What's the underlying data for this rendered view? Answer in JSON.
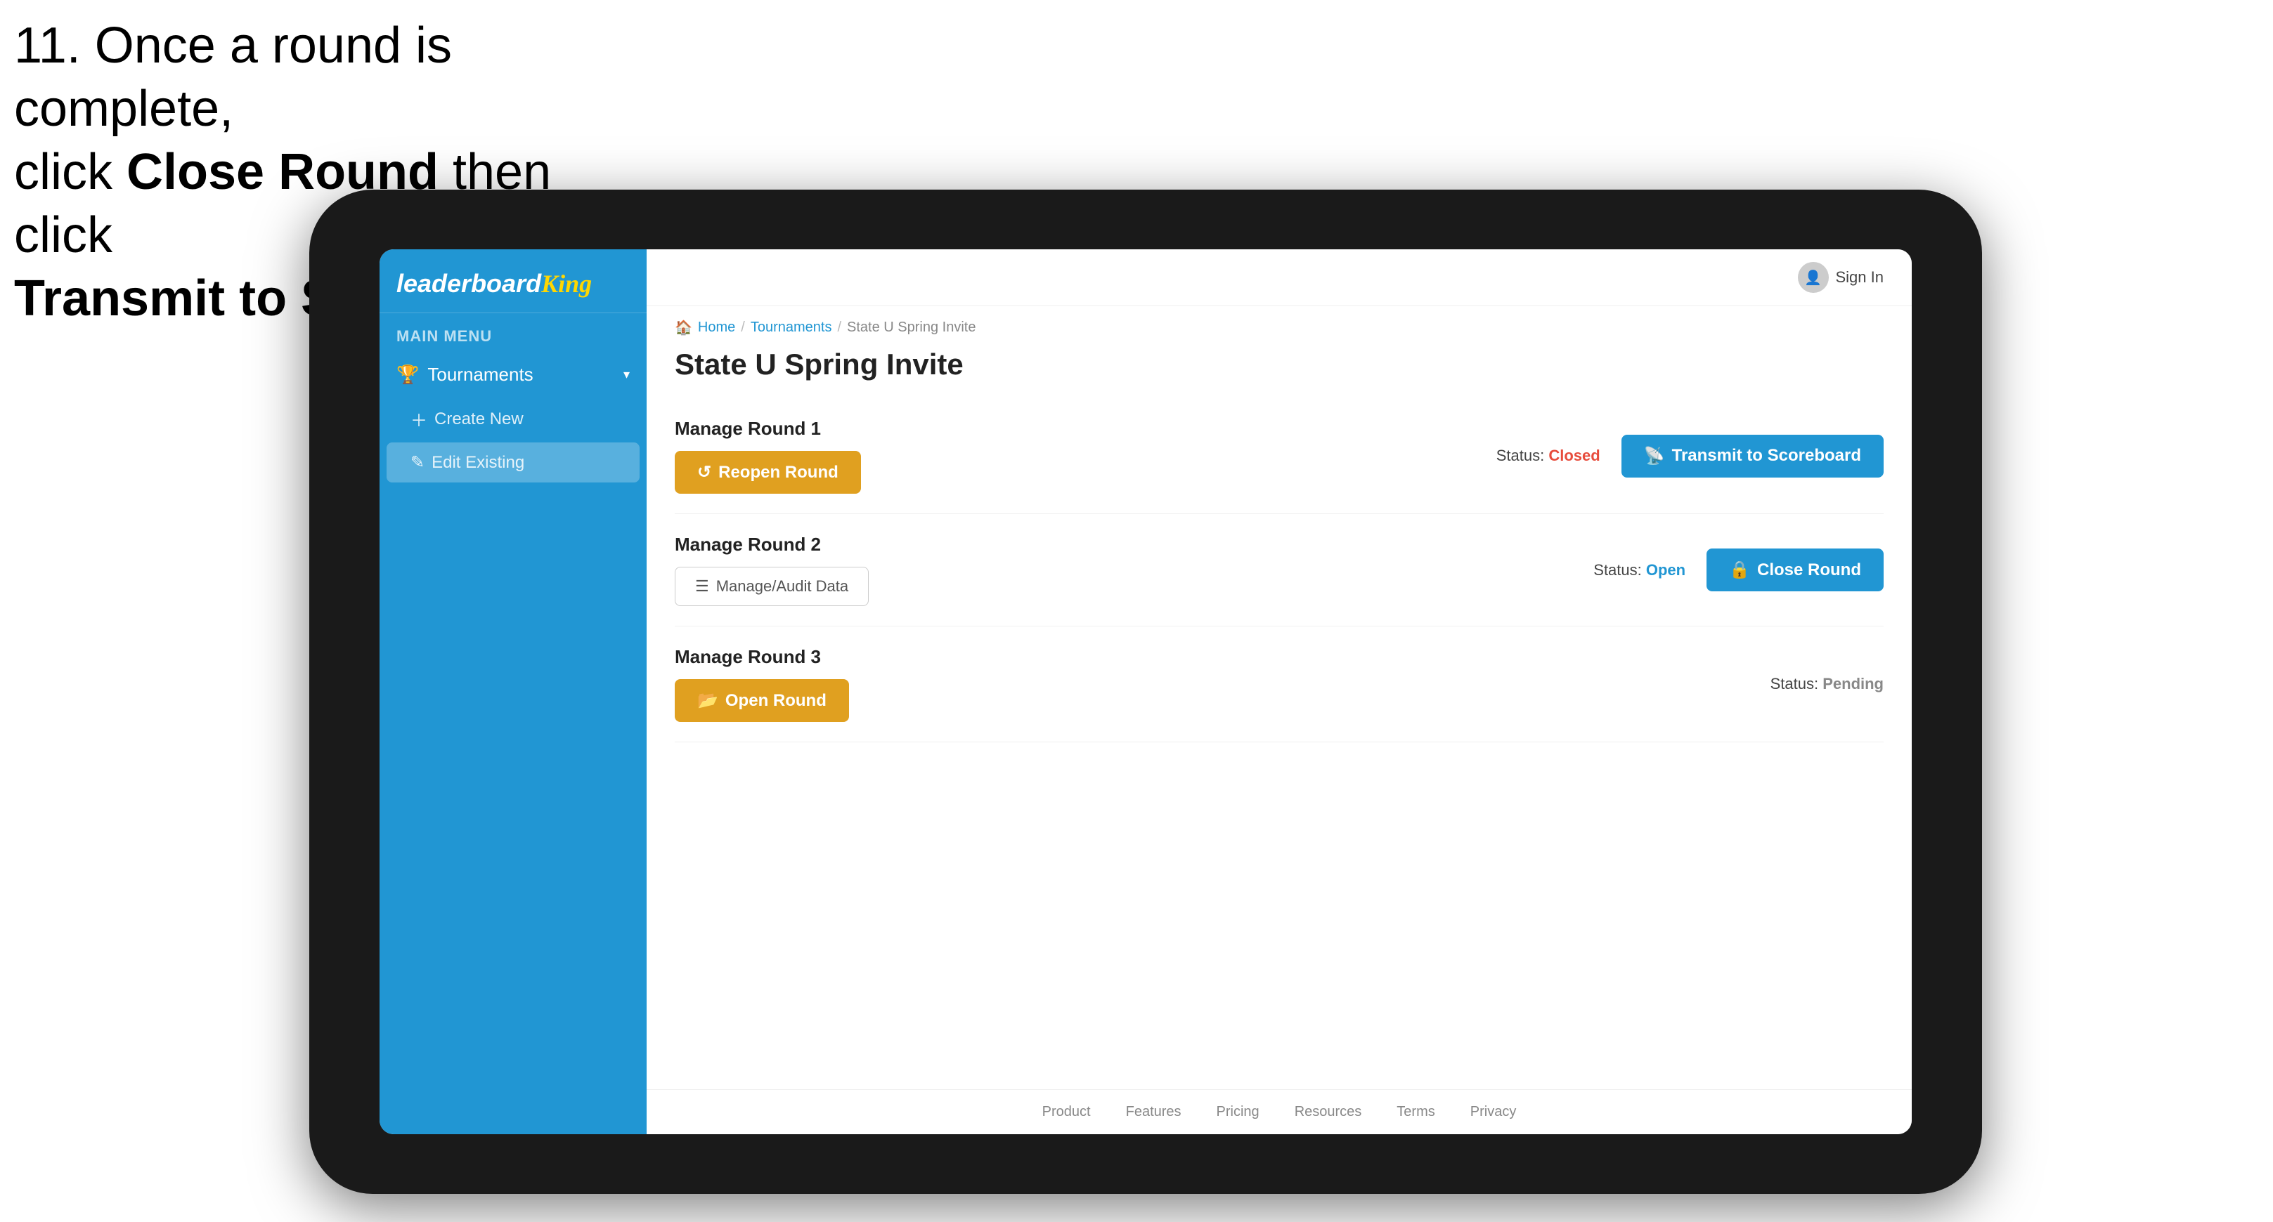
{
  "instruction": {
    "line1": "11. Once a round is complete,",
    "line2": "click ",
    "bold1": "Close Round",
    "line3": " then click",
    "bold2": "Transmit to Scoreboard."
  },
  "sidebar": {
    "logo_text": "leaderboardKing",
    "menu_label": "MAIN MENU",
    "nav_items": [
      {
        "label": "Tournaments",
        "icon": "trophy-icon",
        "expanded": true
      }
    ],
    "sub_items": [
      {
        "label": "Create New",
        "icon": "plus-icon",
        "active": false
      },
      {
        "label": "Edit Existing",
        "icon": "edit-icon",
        "active": true
      }
    ]
  },
  "topbar": {
    "sign_in_label": "Sign In"
  },
  "breadcrumb": {
    "home": "Home",
    "sep1": "/",
    "tournaments": "Tournaments",
    "sep2": "/",
    "current": "State U Spring Invite"
  },
  "page": {
    "title": "State U Spring Invite"
  },
  "rounds": [
    {
      "label": "Manage Round 1",
      "status_label": "Status:",
      "status_value": "Closed",
      "status_type": "closed",
      "btn1_label": "Reopen Round",
      "btn2_label": "Transmit to Scoreboard"
    },
    {
      "label": "Manage Round 2",
      "status_label": "Status:",
      "status_value": "Open",
      "status_type": "open",
      "btn1_label": "Manage/Audit Data",
      "btn2_label": "Close Round"
    },
    {
      "label": "Manage Round 3",
      "status_label": "Status:",
      "status_value": "Pending",
      "status_type": "pending",
      "btn1_label": "Open Round",
      "btn2_label": ""
    }
  ],
  "footer": {
    "links": [
      "Product",
      "Features",
      "Pricing",
      "Resources",
      "Terms",
      "Privacy"
    ]
  },
  "colors": {
    "sidebar_bg": "#2196d3",
    "btn_gold": "#e0a020",
    "btn_blue": "#2196d3",
    "status_closed": "#e74c3c",
    "status_open": "#2196d3",
    "status_pending": "#888888"
  }
}
